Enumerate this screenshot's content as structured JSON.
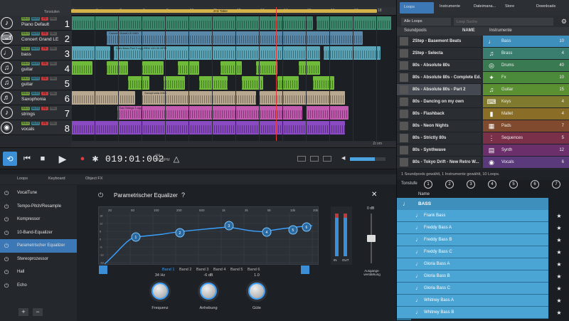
{
  "arrangement": {
    "loop_label": "2Hz Takte",
    "ruler": [
      "5",
      "6",
      "7",
      "8",
      "9",
      "10",
      "11",
      "12",
      "13",
      "14",
      "15",
      "16",
      "17",
      "18"
    ],
    "zoom_label": "Zoom"
  },
  "tracks": [
    {
      "name": "Piano Default",
      "num": "1",
      "icon": "piano-icon",
      "glyph": "♪",
      "color": "#3d8a6e",
      "solo": "SOLO",
      "mute": "MUTE",
      "fx": "FX",
      "rec": "REC"
    },
    {
      "name": "Concert Grand LE",
      "num": "2",
      "icon": "keyboard-icon",
      "glyph": "⌨",
      "color": "#5a88a8",
      "solo": "SOLO",
      "mute": "MUTE",
      "fx": "FX",
      "rec": "REC"
    },
    {
      "name": "bass",
      "num": "3",
      "icon": "bass-icon",
      "glyph": "♩",
      "color": "#5aa6b8",
      "solo": "SOLO",
      "mute": "MUTE",
      "fx": "FX",
      "rec": "REC"
    },
    {
      "name": "guitar",
      "num": "4",
      "icon": "guitar-icon",
      "glyph": "♫",
      "color": "#6fba3a",
      "solo": "SOLO",
      "mute": "MUTE",
      "fx": "FX",
      "rec": "REC"
    },
    {
      "name": "guitar",
      "num": "5",
      "icon": "guitar-icon",
      "glyph": "♫",
      "color": "#6fba3a",
      "solo": "SOLO",
      "mute": "MUTE",
      "fx": "FX",
      "rec": "REC"
    },
    {
      "name": "Saxophonia",
      "num": "6",
      "icon": "saxophone-icon",
      "glyph": "♬",
      "color": "#b8a890",
      "solo": "SOLO",
      "mute": "MUTE",
      "fx": "FX",
      "rec": "REC"
    },
    {
      "name": "strings",
      "num": "7",
      "icon": "strings-icon",
      "glyph": "♪",
      "color": "#c25ab0",
      "solo": "SOLO",
      "mute": "MUTE",
      "fx": "FX",
      "rec": "REC"
    },
    {
      "name": "vocals",
      "num": "8",
      "icon": "vocals-icon",
      "glyph": "◉",
      "color": "#8a4ac2",
      "solo": "SOLO",
      "mute": "MUTE",
      "fx": "FX",
      "rec": "REC"
    }
  ],
  "clip_labels": {
    "track2": "Concert Grand LE MIDI",
    "track3": "Dark Bass Pad 2.ogg  REM  100.00 BPM",
    "track6": "Saxophonia MIDI",
    "track7": "Sax Strings 1.ogg",
    "track1": "Dark Gothic 4.ogg  BPM"
  },
  "transport": {
    "time": "019:01:002",
    "signature_top": "4/4",
    "signature_bpm": "120 BPM"
  },
  "browser": {
    "tabs": [
      "Loops",
      "Instrumente",
      "Dateimana...",
      "Store",
      "Downloads"
    ],
    "select": "Alle Loops",
    "search_placeholder": "Loop Suche",
    "col_soundpools": "Soundpools",
    "col_name": "NAME",
    "col_instrumente": "Instrumente",
    "soundpools": [
      {
        "name": "2Step - Basement Beats",
        "sel": false
      },
      {
        "name": "2Step - Selecta",
        "sel": false
      },
      {
        "name": "80s - Absolute 80s",
        "sel": false
      },
      {
        "name": "80s - Absolute 80s - Complete Ed.",
        "sel": false
      },
      {
        "name": "80s - Absolute 80s - Part 2",
        "sel": true
      },
      {
        "name": "80s - Dancing on my own",
        "sel": false
      },
      {
        "name": "80s - Flashback",
        "sel": false
      },
      {
        "name": "80s - Neon Nights",
        "sel": false
      },
      {
        "name": "80s - Strictly 80s",
        "sel": false
      },
      {
        "name": "80s - Synthwave",
        "sel": false
      },
      {
        "name": "80s - Tokyo Drift - New Retro W...",
        "sel": false
      }
    ],
    "instruments": [
      {
        "name": "Bass",
        "count": "10",
        "color": "#3f8fbd",
        "icon": "bass-icon",
        "glyph": "♩"
      },
      {
        "name": "Brass",
        "count": "4",
        "color": "#3a7e6f",
        "icon": "brass-icon",
        "glyph": "♫"
      },
      {
        "name": "Drums",
        "count": "40",
        "color": "#3a7a52",
        "icon": "drums-icon",
        "glyph": "◎"
      },
      {
        "name": "Fx",
        "count": "10",
        "color": "#4b8a3a",
        "icon": "fx-icon",
        "glyph": "✦"
      },
      {
        "name": "Guitar",
        "count": "15",
        "color": "#5a8f32",
        "icon": "guitar-icon",
        "glyph": "♫"
      },
      {
        "name": "Keys",
        "count": "4",
        "color": "#7f7a2e",
        "icon": "keys-icon",
        "glyph": "⌨"
      },
      {
        "name": "Mallet",
        "count": "4",
        "color": "#8a6e28",
        "icon": "mallet-icon",
        "glyph": "▮"
      },
      {
        "name": "Pads",
        "count": "7",
        "color": "#7f4a2e",
        "icon": "pads-icon",
        "glyph": "▦"
      },
      {
        "name": "Sequences",
        "count": "5",
        "color": "#7a3048",
        "icon": "sequences-icon",
        "glyph": "⋮"
      },
      {
        "name": "Synth",
        "count": "12",
        "color": "#6b2f6b",
        "icon": "synth-icon",
        "glyph": "▤"
      },
      {
        "name": "Vocals",
        "count": "6",
        "color": "#5a3a7a",
        "icon": "vocals-icon",
        "glyph": "◉"
      }
    ],
    "status": "1 Soundpools gewählt, 1 Instrumente gewählt, 10 Loops."
  },
  "bottom": {
    "tabs": [
      "Loops",
      "Keyboard",
      "Object FX"
    ],
    "fx_items": [
      {
        "name": "VocalTune",
        "sel": false
      },
      {
        "name": "Tempo-Pitch/Resample",
        "sel": false
      },
      {
        "name": "Kompressor",
        "sel": false
      },
      {
        "name": "10-Band-Equalizer",
        "sel": false
      },
      {
        "name": "Parametrischer Equalizer",
        "sel": true
      },
      {
        "name": "Stereoprozessor",
        "sel": false
      },
      {
        "name": "Hall",
        "sel": false
      },
      {
        "name": "Echo",
        "sel": false
      }
    ],
    "add_label": "+",
    "remove_label": "−"
  },
  "eq": {
    "title": "Parametrischer Equalizer",
    "help": "?",
    "close": "✕",
    "freq_labels": [
      "20",
      "50",
      "100",
      "200",
      "500",
      "1k",
      "2k",
      "5k",
      "10k",
      "20k"
    ],
    "db_labels": [
      "18",
      "12",
      "6",
      "0",
      "-6",
      "-12",
      "-18"
    ],
    "bands": [
      "Band 1",
      "Band 2",
      "Band 3",
      "Band 4",
      "Band 5",
      "Band 6"
    ],
    "band_points": [
      1,
      2,
      3,
      4,
      5,
      6
    ],
    "out_db": "0 dB",
    "out_label": "Ausgangs-verstärkung",
    "meter_in": "IN",
    "meter_out": "OUT",
    "knobs": [
      {
        "label": "Frequenz",
        "value": "34 Hz"
      },
      {
        "label": "Anhebung",
        "value": "-6 dB"
      },
      {
        "label": "Güte",
        "value": "1.0"
      }
    ]
  },
  "instpanel": {
    "tonstufe_label": "Tonstufe",
    "tonstufe": [
      "1",
      "2",
      "3",
      "4",
      "5",
      "6",
      "7"
    ],
    "name_col": "Name",
    "group": "BASS",
    "items": [
      "Frank Bass",
      "Freddy Bass A",
      "Freddy Bass B",
      "Freddy Bass C",
      "Gloria Bass A",
      "Gloria Bass B",
      "Gloria Bass C",
      "Whitney Bass A",
      "Whitney Bass B"
    ]
  }
}
